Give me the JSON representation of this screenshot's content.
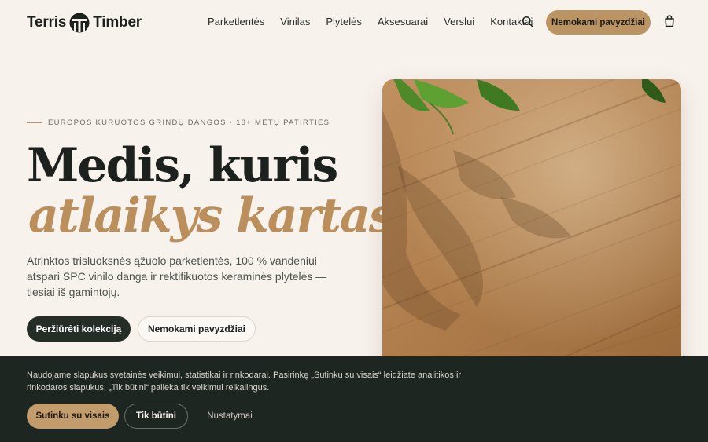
{
  "header": {
    "logo_text_left": "Terris",
    "logo_text_right": "Timber",
    "nav": [
      "Parketlentės",
      "Vinilas",
      "Plytelės",
      "Aksesuarai",
      "Verslui",
      "Kontaktai"
    ],
    "cta_label": "Nemokami pavyzdžiai",
    "icons": {
      "search": "search-icon",
      "cart": "shopping-bag-icon"
    }
  },
  "hero": {
    "eyebrow": "EUROPOS KURUOTOS GRINDŲ DANGOS · 10+ METŲ PATIRTIES",
    "title_line1": "Medis, kuris",
    "title_line2": "atlaikys kartas.",
    "lead": "Atrinktos trisluoksnės ąžuolo parketlentės, 100 % vandeniui atspari SPC vinilo danga ir rektifikuotos keraminės plytelės — tiesiai iš gamintojų.",
    "primary_button": "Peržiūrėti kolekciją",
    "secondary_button": "Nemokami pavyzdžiai"
  },
  "cookie_banner": {
    "text": "Naudojame slapukus svetainės veikimui, statistikai ir rinkodarai. Pasirinkę „Sutinku su visais“ leidžiate analitikos ir rinkodaros slapukus; „Tik būtini“ palieka tik veikimui reikalingus.",
    "accept_all": "Sutinku su visais",
    "essential_only": "Tik būtini",
    "settings": "Nustatymai"
  },
  "colors": {
    "background": "#f8f2ec",
    "accent": "#bb9463",
    "dark": "#1e2621",
    "title_accent": "#bb8f5c"
  }
}
